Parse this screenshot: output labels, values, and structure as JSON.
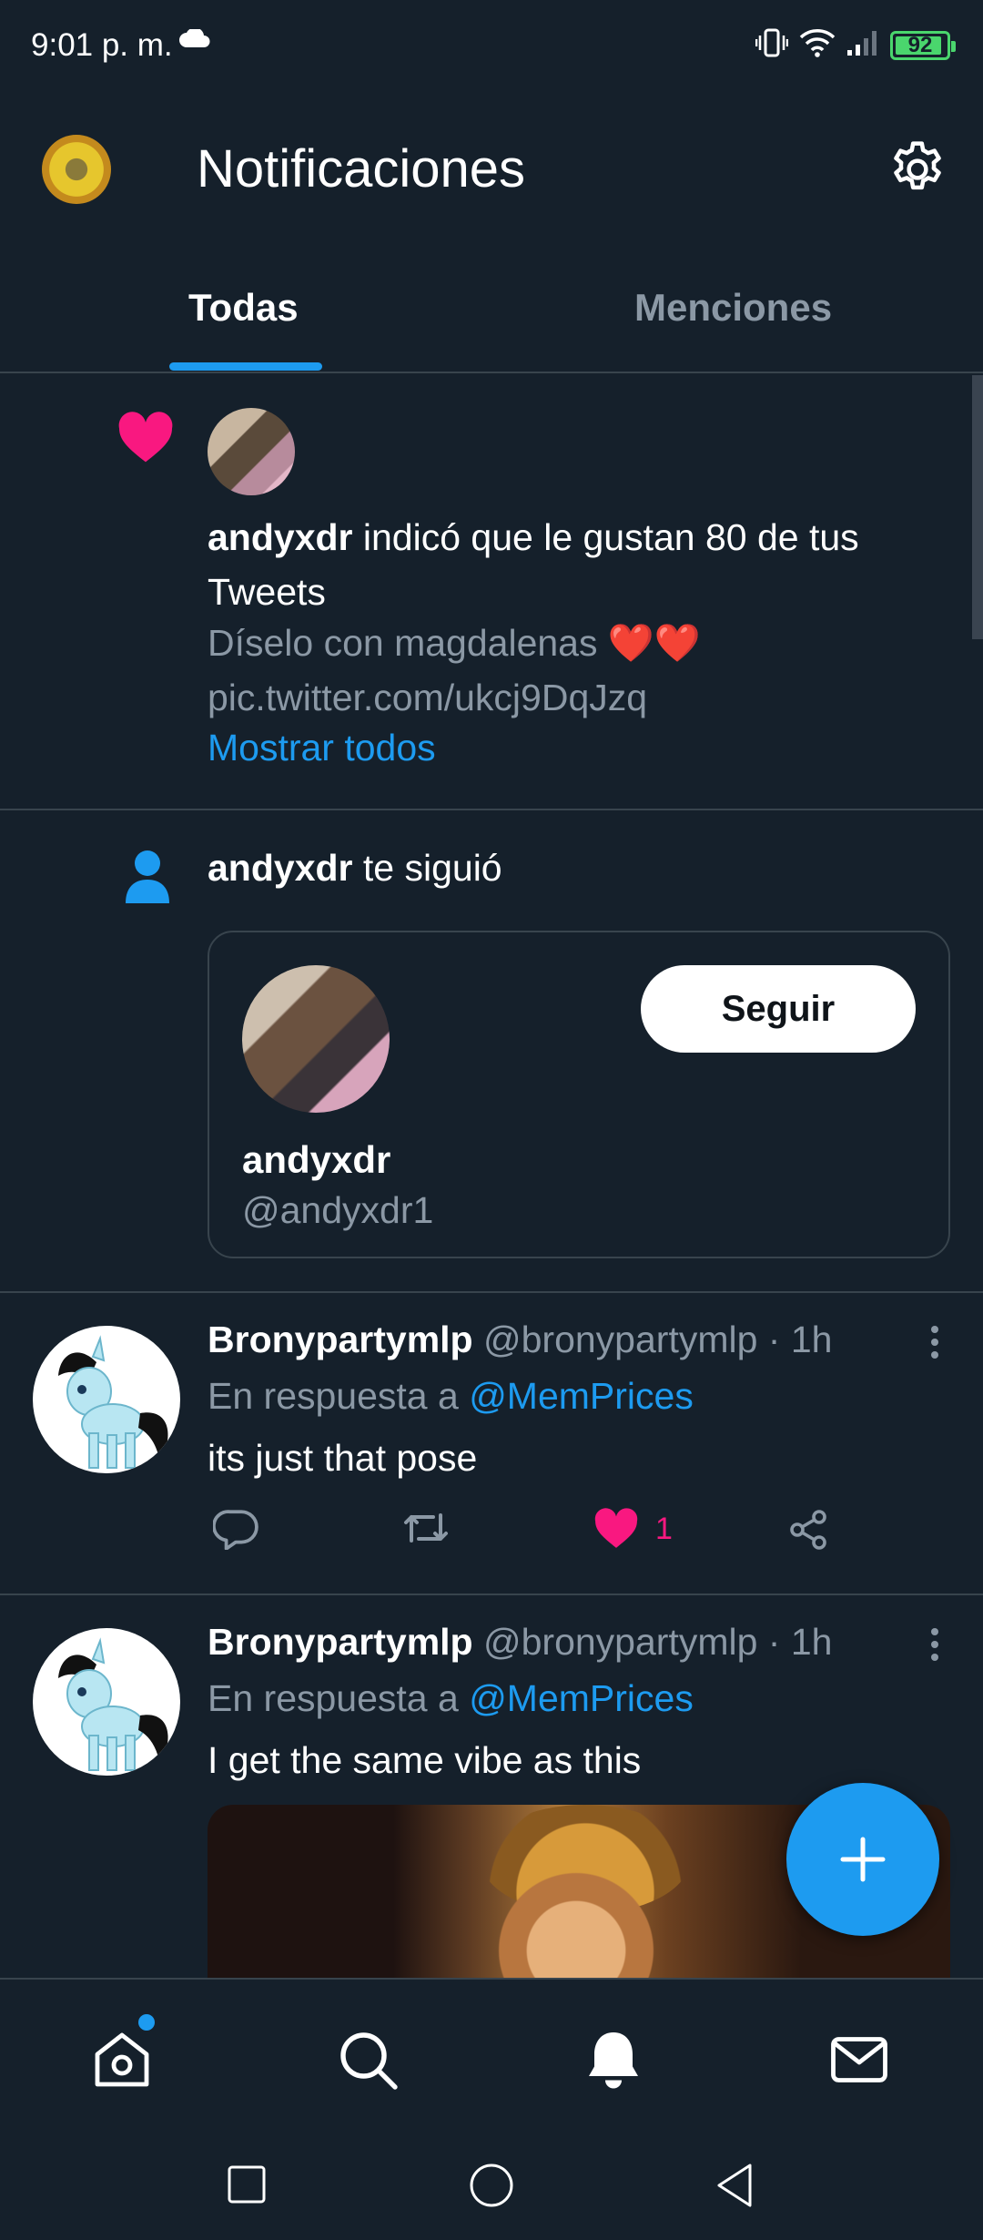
{
  "status_bar": {
    "time": "9:01 p. m.",
    "battery": "92",
    "battery_level": 0.92
  },
  "header": {
    "title": "Notificaciones"
  },
  "tabs": [
    {
      "label": "Todas",
      "active": true
    },
    {
      "label": "Menciones",
      "active": false
    }
  ],
  "like_notification": {
    "user": "andyxdr",
    "text": " indicó que le gustan 80 de tus Tweets",
    "tweet_text": "Díselo con magdalenas ",
    "tweet_hearts": "❤️❤️",
    "tweet_link": "pic.twitter.com/ukcj9DqJzq",
    "show_all": "Mostrar todos"
  },
  "follow_notification": {
    "user": "andyxdr",
    "text": " te siguió",
    "card": {
      "name": "andyxdr",
      "handle": "@andyxdr1",
      "button": "Seguir"
    }
  },
  "tweets": [
    {
      "name": "Bronypartymlp",
      "meta": " @bronypartymlp · 1h",
      "reply_prefix": "En respuesta a ",
      "reply_mention": "@MemPrices",
      "text": "its just that pose",
      "likes": "1"
    },
    {
      "name": "Bronypartymlp",
      "meta": " @bronypartymlp · 1h",
      "reply_prefix": "En respuesta a ",
      "reply_mention": "@MemPrices",
      "text": "I get the same vibe as this"
    }
  ],
  "colors": {
    "background": "#15202b",
    "accent": "#1d9bf0",
    "like": "#f91880",
    "muted": "#8b98a5",
    "divider": "#38444d"
  },
  "icons": {
    "header": [
      "settings-gear-icon"
    ],
    "nav": [
      "home-icon",
      "search-icon",
      "notifications-bell-icon",
      "mail-icon"
    ],
    "system": [
      "recents-square-icon",
      "home-circle-icon",
      "back-triangle-icon"
    ]
  }
}
